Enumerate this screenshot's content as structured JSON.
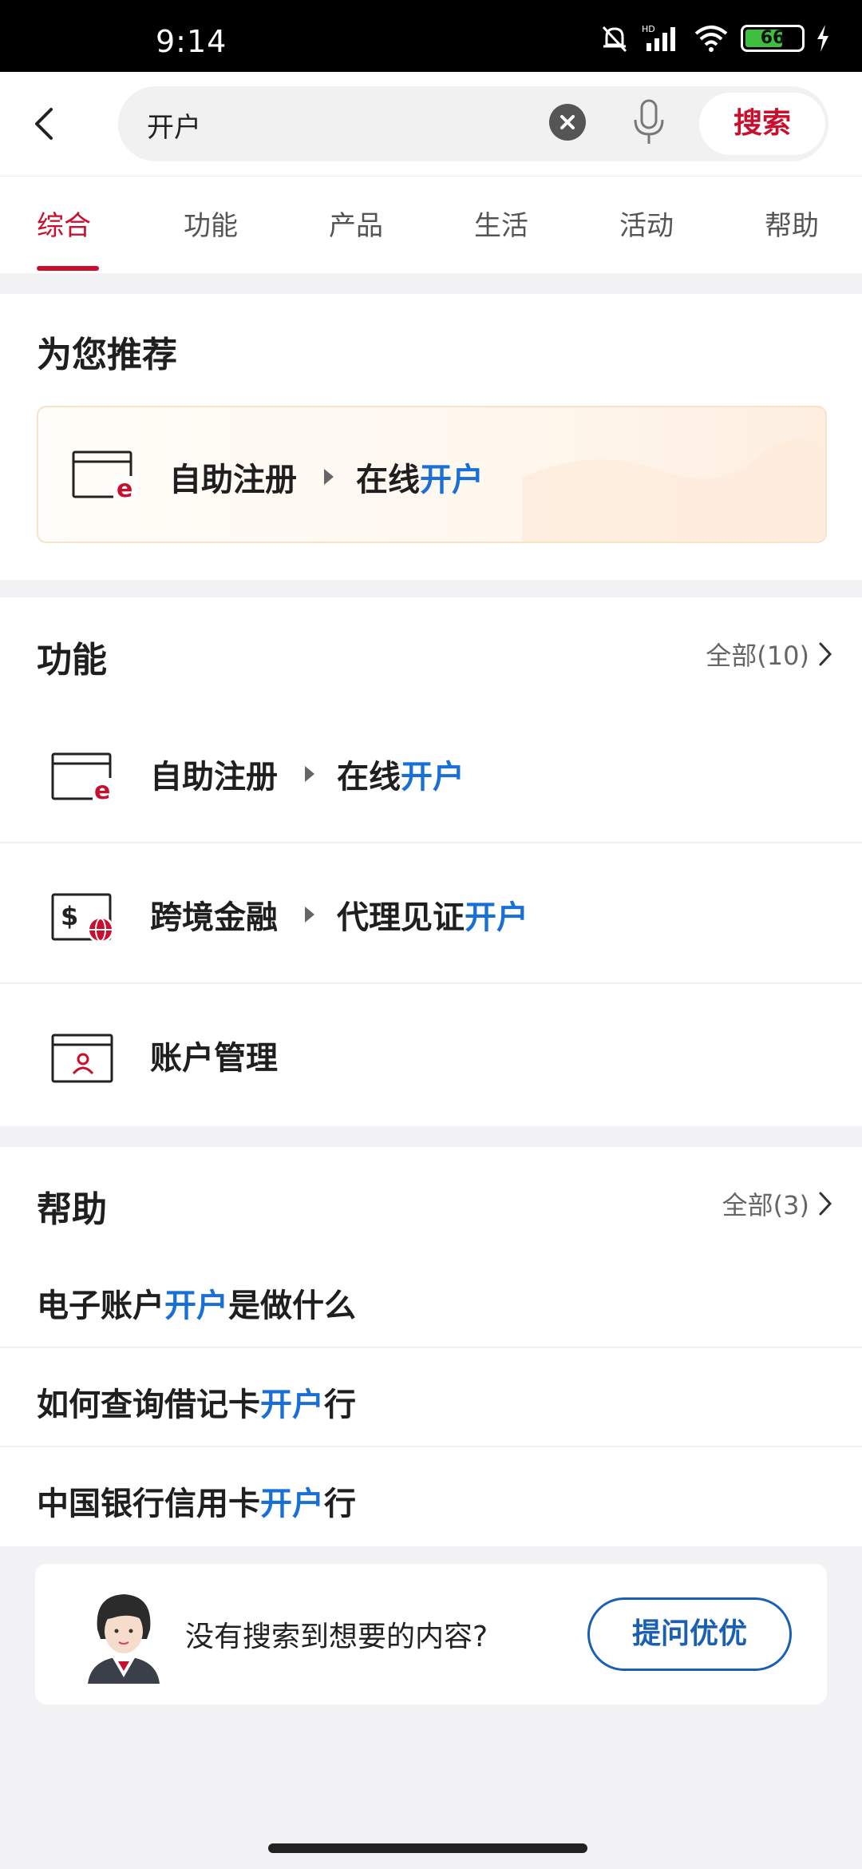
{
  "status_bar": {
    "time": "9:14",
    "battery": "66",
    "network": "HD"
  },
  "search": {
    "query": "开户",
    "button_label": "搜索"
  },
  "tabs": [
    {
      "label": "综合"
    },
    {
      "label": "功能"
    },
    {
      "label": "产品"
    },
    {
      "label": "生活"
    },
    {
      "label": "活动"
    },
    {
      "label": "帮助"
    }
  ],
  "recommend": {
    "title": "为您推荐",
    "item": {
      "prefix": "自助注册",
      "text": "在线",
      "highlight": "开户"
    }
  },
  "functions": {
    "title": "功能",
    "more": "全部(10)",
    "items": [
      {
        "prefix": "自助注册",
        "text": "在线",
        "highlight": "开户",
        "icon": "card-e-icon"
      },
      {
        "prefix": "跨境金融",
        "text": "代理见证",
        "highlight": "开户",
        "icon": "cross-border-icon"
      },
      {
        "prefix": "账户管理",
        "text": "",
        "highlight": "",
        "icon": "account-icon"
      }
    ]
  },
  "help": {
    "title": "帮助",
    "more": "全部(3)",
    "items": [
      {
        "before": "电子账户",
        "highlight": "开户",
        "after": "是做什么"
      },
      {
        "before": "如何查询借记卡",
        "highlight": "开户",
        "after": "行"
      },
      {
        "before": "中国银行信用卡",
        "highlight": "开户",
        "after": "行"
      }
    ]
  },
  "ask": {
    "text": "没有搜索到想要的内容?",
    "button": "提问优优"
  },
  "colors": {
    "brand_red": "#c8102e",
    "highlight_blue": "#1a6fd6"
  }
}
